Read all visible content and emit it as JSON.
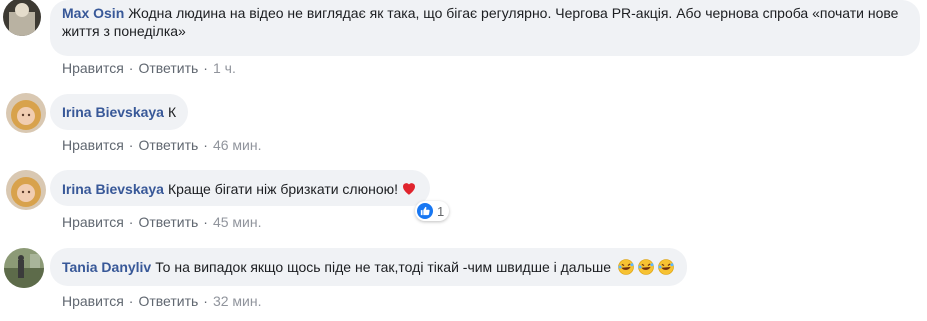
{
  "comments": [
    {
      "author": "Max Osin",
      "text": "Жодна людина на відео не виглядає як така, що бігає регулярно. Чергова PR-акція. Або чернова спроба «почати нове життя з понеділка»",
      "like": "Нравится",
      "reply": "Ответить",
      "time": "1 ч."
    },
    {
      "author": "Irina Bievskaya",
      "text": "К",
      "like": "Нравится",
      "reply": "Ответить",
      "time": "46 мин."
    },
    {
      "author": "Irina Bievskaya",
      "text": "Краще бігати ніж бризкати слюною!",
      "like": "Нравится",
      "reply": "Ответить",
      "time": "45 мин.",
      "reaction_count": "1",
      "emoji": "red-heart-icon"
    },
    {
      "author": "Tania Danyliv",
      "text": "То на випадок якщо щось піде не так,тоді тікай -чим швидше і дальше",
      "like": "Нравится",
      "reply": "Ответить",
      "time": "32 мин.",
      "emoji": "rolling-on-floor-laughing-icon"
    }
  ],
  "colors": {
    "author": "#385898",
    "bubble": "#f0f2f5",
    "meta": "#606770",
    "like_blue": "#1877f2",
    "heart_red": "#e0242d"
  }
}
